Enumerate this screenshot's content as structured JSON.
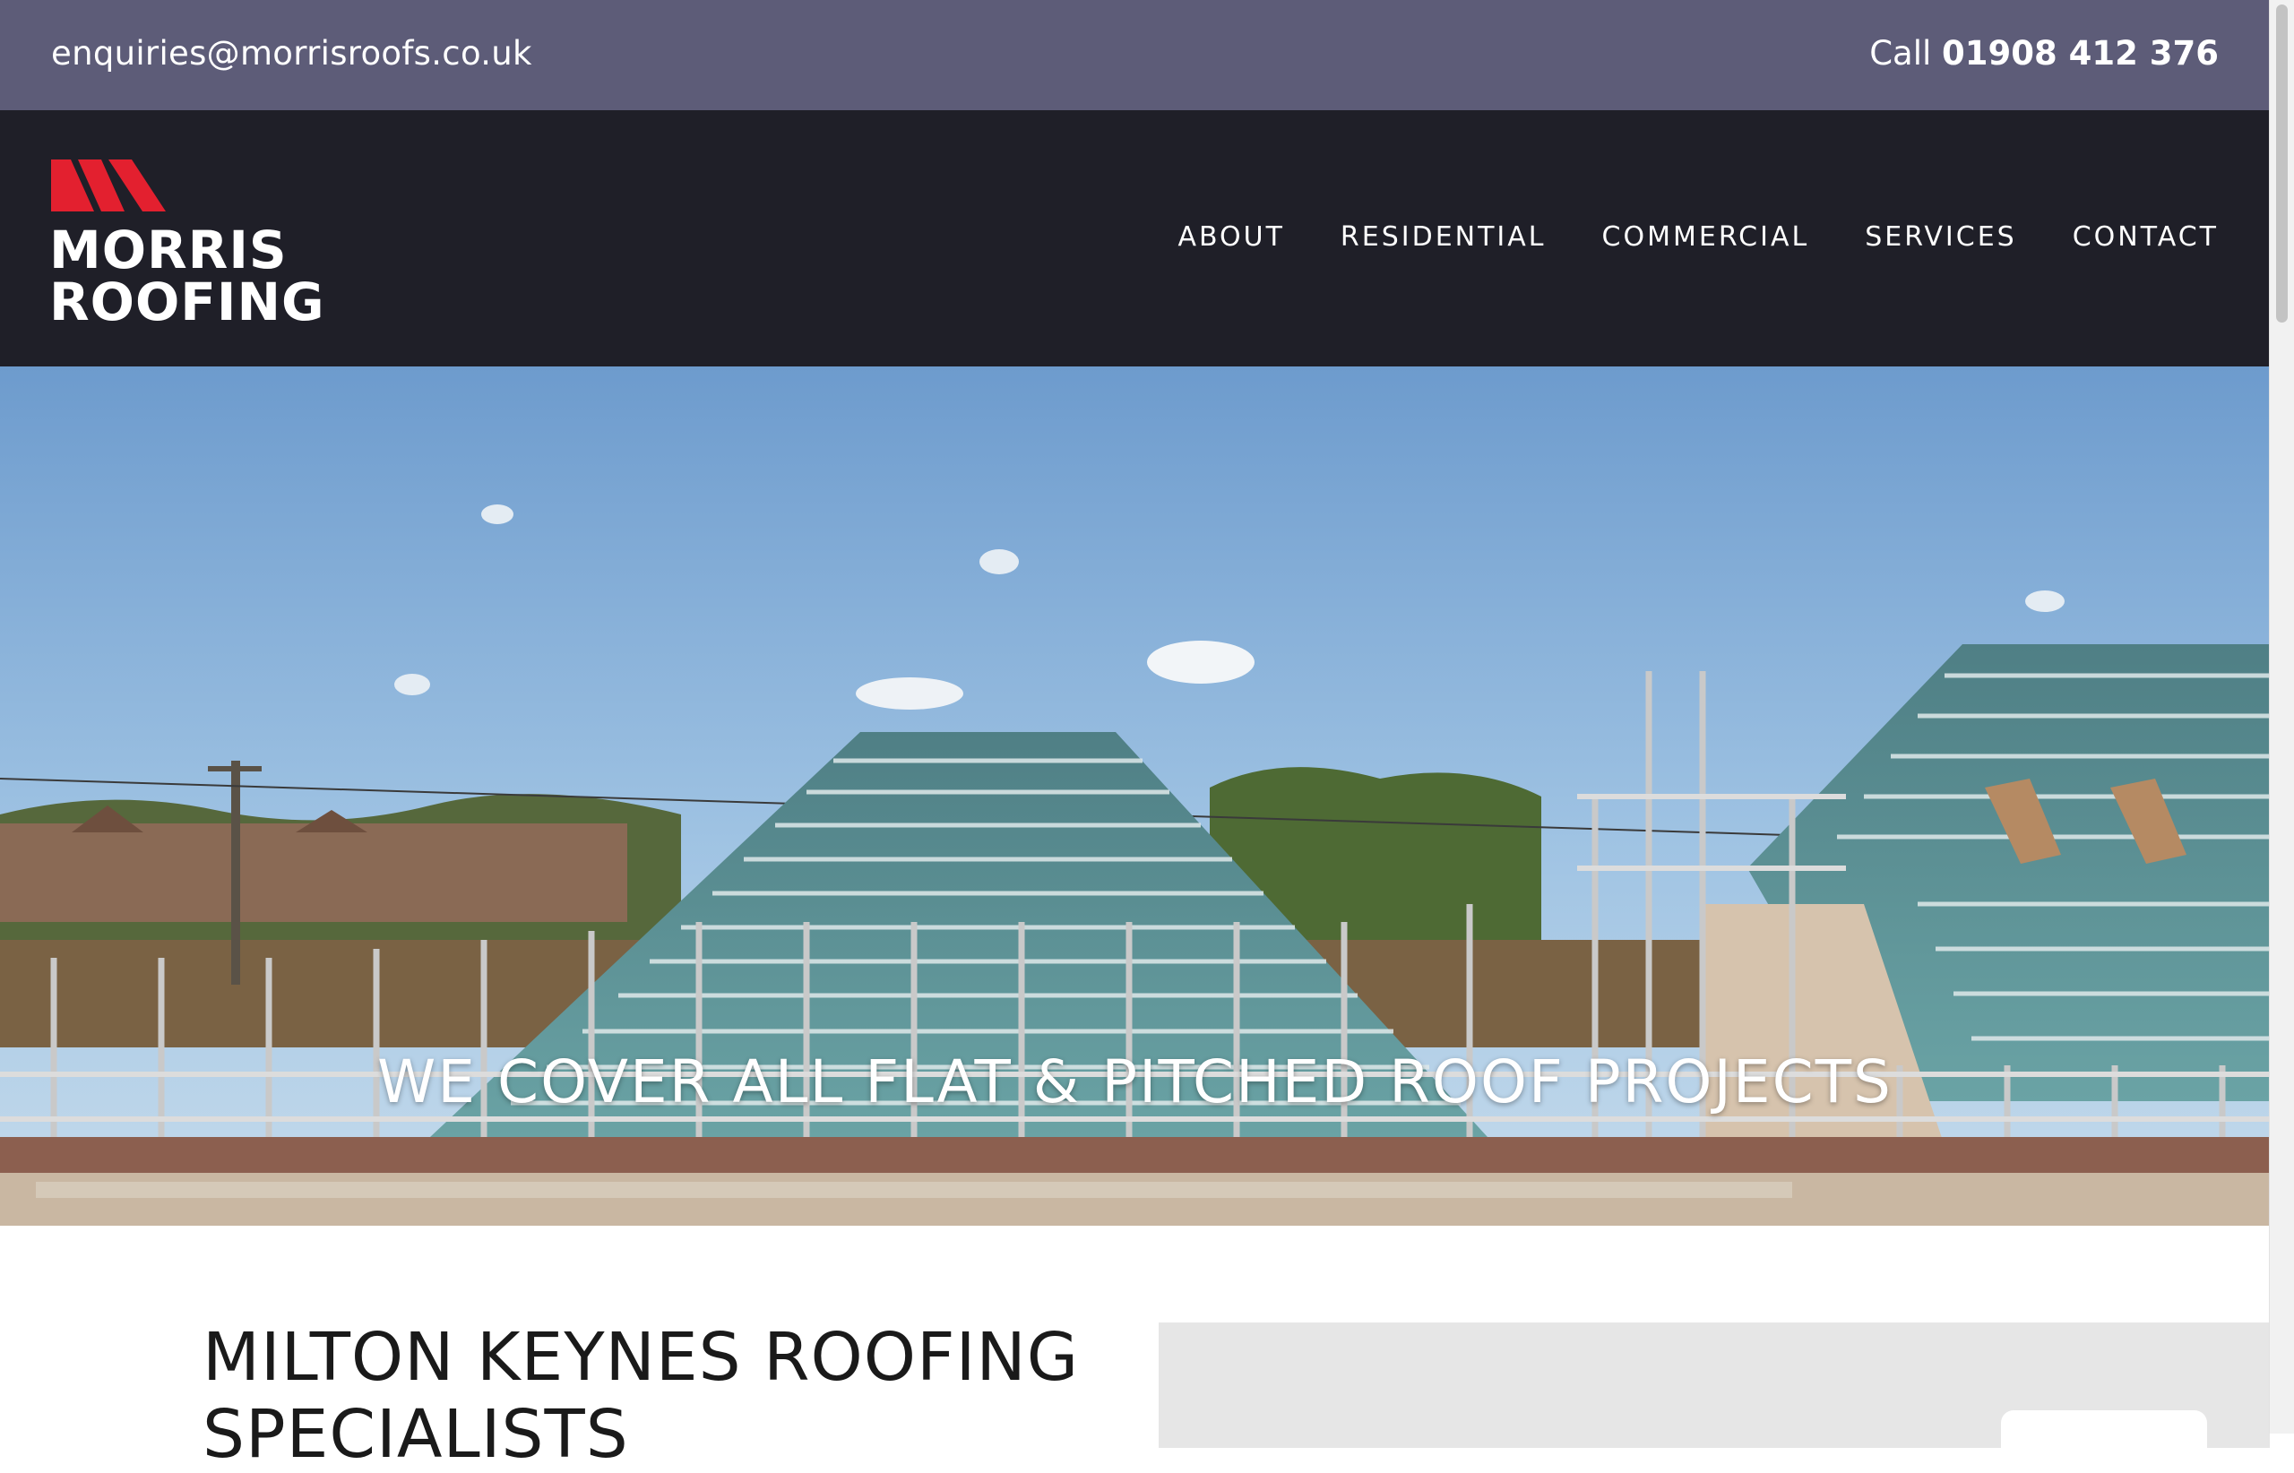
{
  "topbar": {
    "email": "enquiries@morrisroofs.co.uk",
    "phone_prefix": "Call",
    "phone_number": "01908 412 376"
  },
  "brand": {
    "line1": "MORRIS",
    "line2": "ROOFING",
    "accent_color": "#e3202f"
  },
  "nav": {
    "items": [
      "ABOUT",
      "RESIDENTIAL",
      "COMMERCIAL",
      "SERVICES",
      "CONTACT"
    ]
  },
  "hero": {
    "tagline": "WE COVER ALL FLAT & PITCHED ROOF PROJECTS"
  },
  "intro": {
    "title_line1": "MILTON KEYNES ROOFING",
    "title_line2": "SPECIALISTS"
  },
  "colors": {
    "topbar": "#5d5c78",
    "header": "#1f1f28"
  }
}
